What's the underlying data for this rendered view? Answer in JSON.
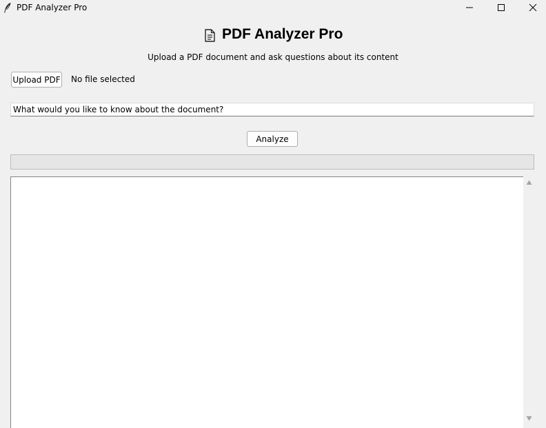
{
  "window": {
    "title": "PDF Analyzer Pro",
    "icon": "feather-icon",
    "controls": [
      "minimize-icon",
      "maximize-icon",
      "close-icon"
    ]
  },
  "header": {
    "icon": "document-icon",
    "title": "PDF Analyzer Pro",
    "subtitle": "Upload a PDF document and ask questions about its content"
  },
  "upload": {
    "button_label": "Upload PDF",
    "status": "No file selected"
  },
  "question": {
    "value": "What would you like to know about the document?"
  },
  "analyze": {
    "button_label": "Analyze"
  },
  "progress": {
    "value": 0
  },
  "output": {
    "text": ""
  },
  "colors": {
    "window_bg": "#f0f0f0",
    "output_bg": "#ffffff",
    "progress_track": "#e6e6e6"
  }
}
